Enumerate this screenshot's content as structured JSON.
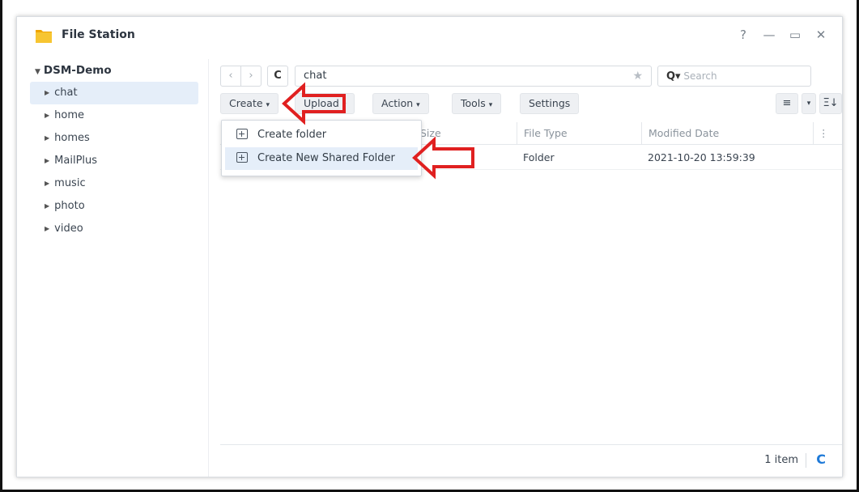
{
  "window": {
    "title": "File Station",
    "controls": [
      "?",
      "—",
      "▭",
      "✕"
    ]
  },
  "sidebar": {
    "root_label": "DSM-Demo",
    "items": [
      {
        "label": "chat",
        "selected": true
      },
      {
        "label": "home",
        "selected": false
      },
      {
        "label": "homes",
        "selected": false
      },
      {
        "label": "MailPlus",
        "selected": false
      },
      {
        "label": "music",
        "selected": false
      },
      {
        "label": "photo",
        "selected": false
      },
      {
        "label": "video",
        "selected": false
      }
    ]
  },
  "navbar": {
    "back_glyph": "‹",
    "forward_glyph": "›",
    "refresh_glyph": "C",
    "path": "chat",
    "star_glyph": "★",
    "search_glyph": "Q▾",
    "search_placeholder": "Search"
  },
  "toolbar": {
    "create": "Create",
    "upload": "Upload",
    "action": "Action",
    "tools": "Tools",
    "settings": "Settings",
    "list_view_glyph": "≡",
    "view_dropdown_glyph": "▾",
    "sort_glyph": "Ξ↓"
  },
  "grid": {
    "columns": [
      "Size",
      "File Type",
      "Modified Date"
    ],
    "rows": [
      {
        "size": "",
        "type": "Folder",
        "modified": "2021-10-20 13:59:39"
      }
    ]
  },
  "create_menu": {
    "items": [
      {
        "label": "Create folder"
      },
      {
        "label": "Create New Shared Folder"
      }
    ]
  },
  "status": {
    "count": "1 item",
    "refresh_glyph": "C"
  },
  "colors": {
    "annotation_red": "#e02020",
    "selection": "#e5eef9",
    "accent_blue": "#1f7ad8",
    "folder_yellow": "#f4b400"
  }
}
